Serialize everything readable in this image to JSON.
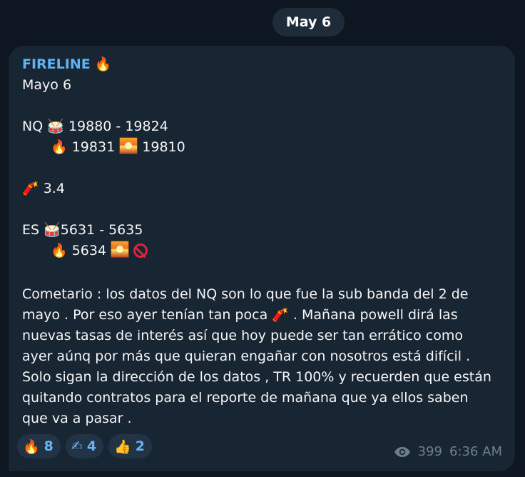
{
  "date_label": "May 6",
  "message": {
    "sender": "FIRELINE",
    "sender_emoji": "🔥",
    "lines": {
      "l1": "Mayo 6",
      "nq_prefix": "NQ",
      "nq_range": "19880 - 19824",
      "nq_fire": "19831",
      "nq_sunset": "19810",
      "dyn_value": "3.4",
      "es_prefix": "ES",
      "es_range": "5631 - 5635",
      "es_fire": "5634"
    },
    "comment": "Cometario : los datos del NQ son lo que fue la sub banda del 2 de\nmayo . Por eso ayer tenían tan poca 🧨 .  Mañana powell dirá las\nnuevas tasas de interés así que hoy puede ser tan errático como\nayer aúnq por más que quieran engañar con nosotros está difícil .\nSolo sigan la dirección de los datos , TR 100% y recuerden que están\nquitando contratos para el reporte de mañana que ya ellos saben\nque va a pasar ."
  },
  "icons": {
    "fire": "🔥",
    "drum": "🥁",
    "dynamite": "🧨",
    "writing_hand": "✍",
    "thumbs_up": "👍"
  },
  "reactions": [
    {
      "emoji": "🔥",
      "count": "8"
    },
    {
      "emoji": "✍",
      "count": "4"
    },
    {
      "emoji": "👍",
      "count": "2"
    }
  ],
  "meta": {
    "views": "399",
    "time": "6:36 AM"
  },
  "colors": {
    "background": "#0e1621",
    "bubble": "#182533",
    "sender": "#5fb3f5",
    "reaction_count": "#6ab3f3"
  }
}
